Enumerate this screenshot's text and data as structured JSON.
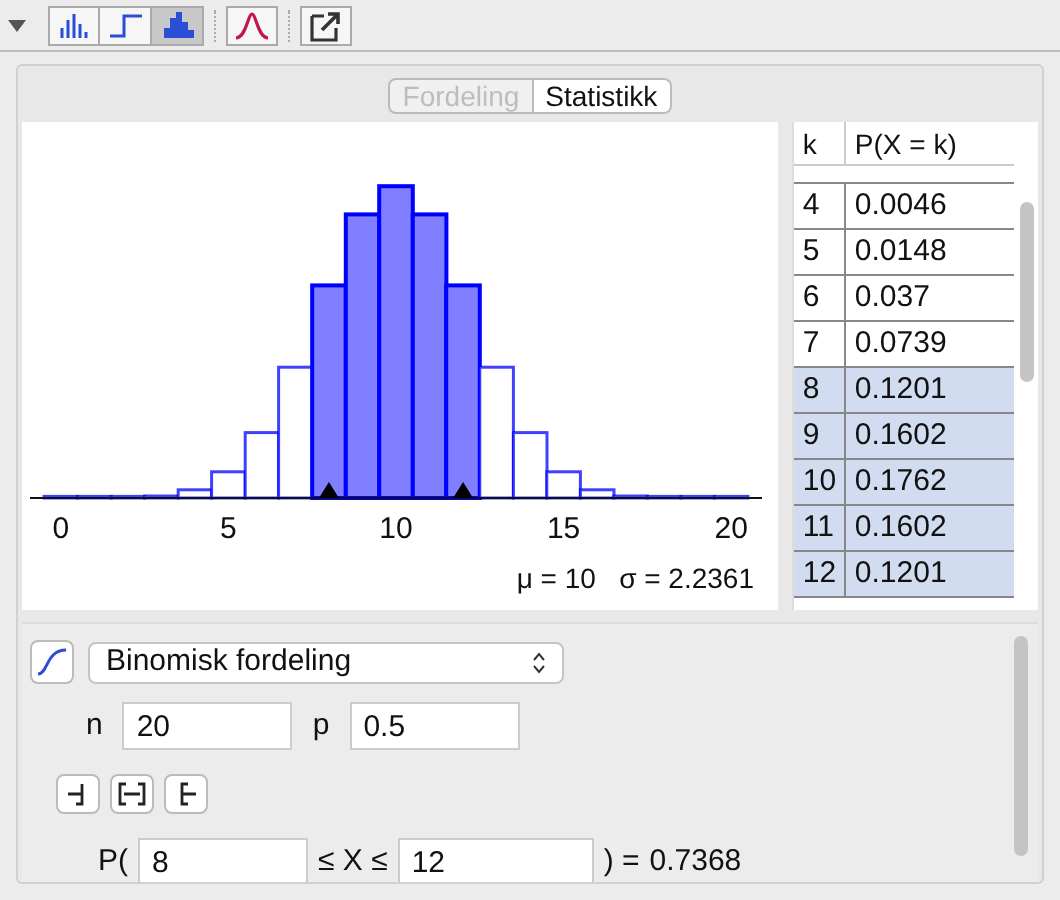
{
  "toolbar": {
    "groups": [
      [
        {
          "kind": "bars",
          "selected": false
        },
        {
          "kind": "step",
          "selected": false
        },
        {
          "kind": "histogram",
          "selected": true
        }
      ],
      [
        {
          "kind": "normal-curve",
          "selected": false
        }
      ],
      [
        {
          "kind": "export",
          "selected": false
        }
      ]
    ]
  },
  "tabs": [
    {
      "label": "Fordeling",
      "selected": false
    },
    {
      "label": "Statistikk",
      "selected": true
    }
  ],
  "plot": {
    "axis_labels": [
      "0",
      "5",
      "10",
      "15",
      "20"
    ],
    "stats": "μ = 10   σ = 2.2361"
  },
  "table": {
    "columns": [
      "k",
      "P(X = k)"
    ],
    "rows": [
      {
        "cells": [
          "4",
          "0.0046"
        ],
        "selected": false
      },
      {
        "cells": [
          "5",
          "0.0148"
        ],
        "selected": false
      },
      {
        "cells": [
          "6",
          "0.037"
        ],
        "selected": false
      },
      {
        "cells": [
          "7",
          "0.0739"
        ],
        "selected": false
      },
      {
        "cells": [
          "8",
          "0.1201"
        ],
        "selected": true
      },
      {
        "cells": [
          "9",
          "0.1602"
        ],
        "selected": true
      },
      {
        "cells": [
          "10",
          "0.1762"
        ],
        "selected": true
      },
      {
        "cells": [
          "11",
          "0.1602"
        ],
        "selected": true
      },
      {
        "cells": [
          "12",
          "0.1201"
        ],
        "selected": true
      }
    ]
  },
  "distribution": {
    "value": "Binomisk fordeling",
    "params": [
      {
        "label": "n",
        "value": "20"
      },
      {
        "label": "p",
        "value": "0.5"
      }
    ]
  },
  "interval_buttons": [
    {
      "kind": "left-sided"
    },
    {
      "kind": "interval"
    },
    {
      "kind": "right-sided"
    }
  ],
  "probability": {
    "prefix": "P(",
    "low": "8",
    "middle": "≤ X ≤",
    "high": "12",
    "suffix": ") =",
    "result": "0.7368"
  }
}
